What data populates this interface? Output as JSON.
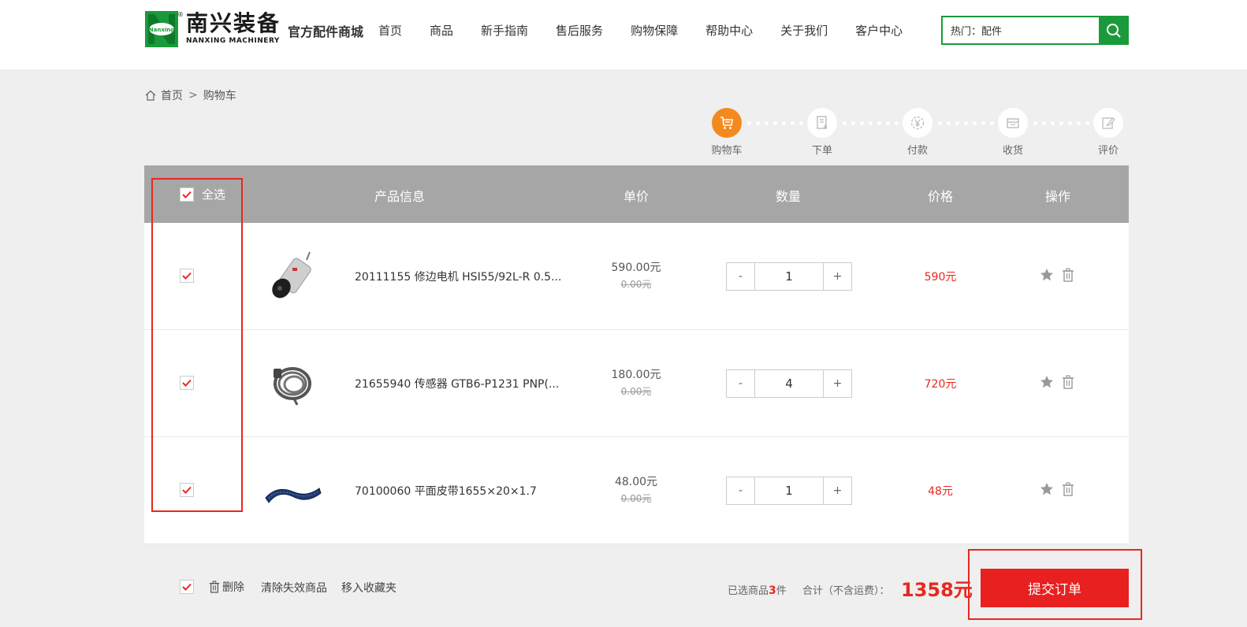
{
  "header": {
    "logo_cn": "南兴装备",
    "logo_en": "NANXING MACHINERY",
    "logo_mark_text": "Nanxing",
    "logo_reg": "®",
    "mall_title": "官方配件商城",
    "nav": [
      "首页",
      "商品",
      "新手指南",
      "售后服务",
      "购物保障",
      "帮助中心",
      "关于我们",
      "客户中心"
    ],
    "search_value": "热门：配件",
    "brand_color": "#1a9a3a"
  },
  "breadcrumb": {
    "home": "首页",
    "sep": ">",
    "current": "购物车"
  },
  "steps": [
    {
      "label": "购物车",
      "icon": "cart-icon",
      "active": true
    },
    {
      "label": "下单",
      "icon": "order-icon",
      "active": false
    },
    {
      "label": "付款",
      "icon": "yen-icon",
      "active": false
    },
    {
      "label": "收货",
      "icon": "box-icon",
      "active": false
    },
    {
      "label": "评价",
      "icon": "edit-icon",
      "active": false
    }
  ],
  "table_head": {
    "select_all": "全选",
    "product": "产品信息",
    "unit_price": "单价",
    "quantity": "数量",
    "price": "价格",
    "actions": "操作"
  },
  "items": [
    {
      "name": "20111155 修边电机 HSI55/92L-R 0.5...",
      "price": "590.00元",
      "old_price": "0.00元",
      "qty": "1",
      "total": "590元",
      "checked": true,
      "image": "motor"
    },
    {
      "name": "21655940 传感器 GTB6-P1231 PNP(...",
      "price": "180.00元",
      "old_price": "0.00元",
      "qty": "4",
      "total": "720元",
      "checked": true,
      "image": "sensor-cable"
    },
    {
      "name": "70100060 平面皮带1655×20×1.7",
      "price": "48.00元",
      "old_price": "0.00元",
      "qty": "1",
      "total": "48元",
      "checked": true,
      "image": "belt"
    }
  ],
  "qty_minus": "-",
  "qty_plus": "+",
  "footer": {
    "delete": "删除",
    "clear_invalid": "清除失效商品",
    "move_to_fav": "移入收藏夹",
    "selected_prefix": "已选商品",
    "selected_count": "3",
    "selected_suffix": "件",
    "sum_label": "合计（不含运费）：",
    "amount": "1358元",
    "submit": "提交订单"
  },
  "colors": {
    "accent_orange": "#f48a1f",
    "price_red": "#e8281f",
    "submit_red": "#e8201f"
  }
}
